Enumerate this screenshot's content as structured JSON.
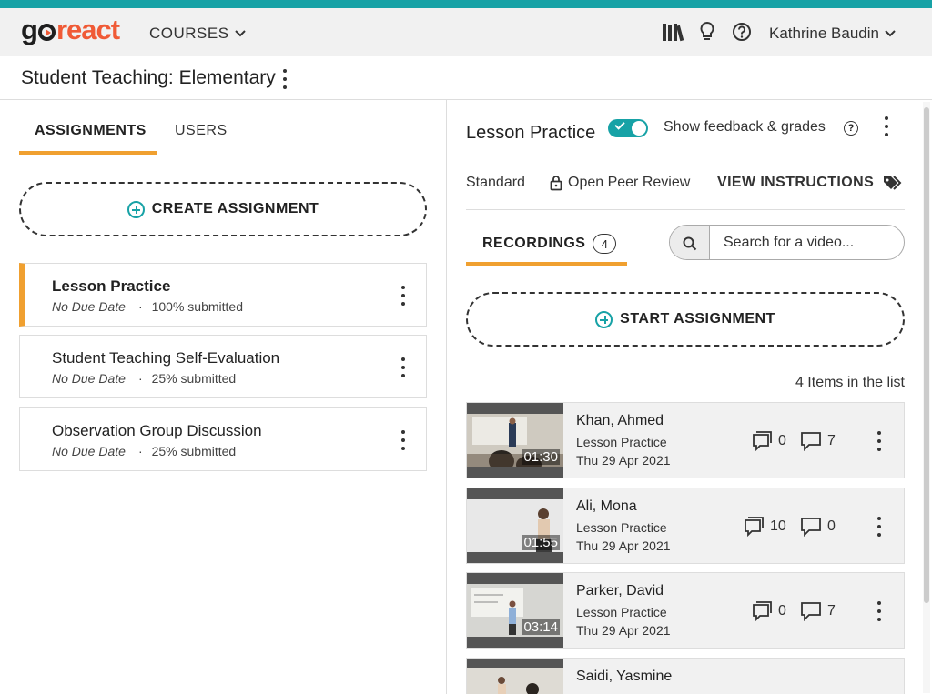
{
  "header": {
    "brand_go": "go",
    "brand_react": "react",
    "courses_label": "COURSES",
    "user_name": "Kathrine Baudin"
  },
  "course": {
    "title": "Student Teaching: Elementary"
  },
  "left_tabs": [
    {
      "label": "ASSIGNMENTS",
      "active": true
    },
    {
      "label": "USERS",
      "active": false
    }
  ],
  "create_assignment_label": "CREATE ASSIGNMENT",
  "assignments": [
    {
      "name": "Lesson Practice",
      "due": "No Due Date",
      "submitted": "100% submitted",
      "active": true
    },
    {
      "name": "Student Teaching Self-Evaluation",
      "due": "No Due Date",
      "submitted": "25% submitted",
      "active": false
    },
    {
      "name": "Observation Group Discussion",
      "due": "No Due Date",
      "submitted": "25% submitted",
      "active": false
    }
  ],
  "detail": {
    "title": "Lesson Practice",
    "toggle_on": true,
    "feedback_label": "Show feedback & grades",
    "type": "Standard",
    "review": "Open Peer Review",
    "view_instructions": "VIEW INSTRUCTIONS",
    "recordings_tab": "RECORDINGS",
    "recordings_count": "4",
    "search_placeholder": "Search for a video...",
    "start_assignment_label": "START ASSIGNMENT",
    "items_count": "4 Items in the list"
  },
  "recordings": [
    {
      "name": "Khan, Ahmed",
      "assignment": "Lesson Practice",
      "date": "Thu 29 Apr 2021",
      "duration": "01:30",
      "comments": "0",
      "feedback": "7"
    },
    {
      "name": "Ali, Mona",
      "assignment": "Lesson Practice",
      "date": "Thu 29 Apr 2021",
      "duration": "01:55",
      "comments": "10",
      "feedback": "0"
    },
    {
      "name": "Parker, David",
      "assignment": "Lesson Practice",
      "date": "Thu 29 Apr 2021",
      "duration": "03:14",
      "comments": "0",
      "feedback": "7"
    },
    {
      "name": "Saidi, Yasmine",
      "assignment": "",
      "date": "",
      "duration": "",
      "comments": "",
      "feedback": ""
    }
  ],
  "colors": {
    "teal": "#17a2a6",
    "orange": "#f0a030",
    "brand_react": "#f05a36"
  }
}
